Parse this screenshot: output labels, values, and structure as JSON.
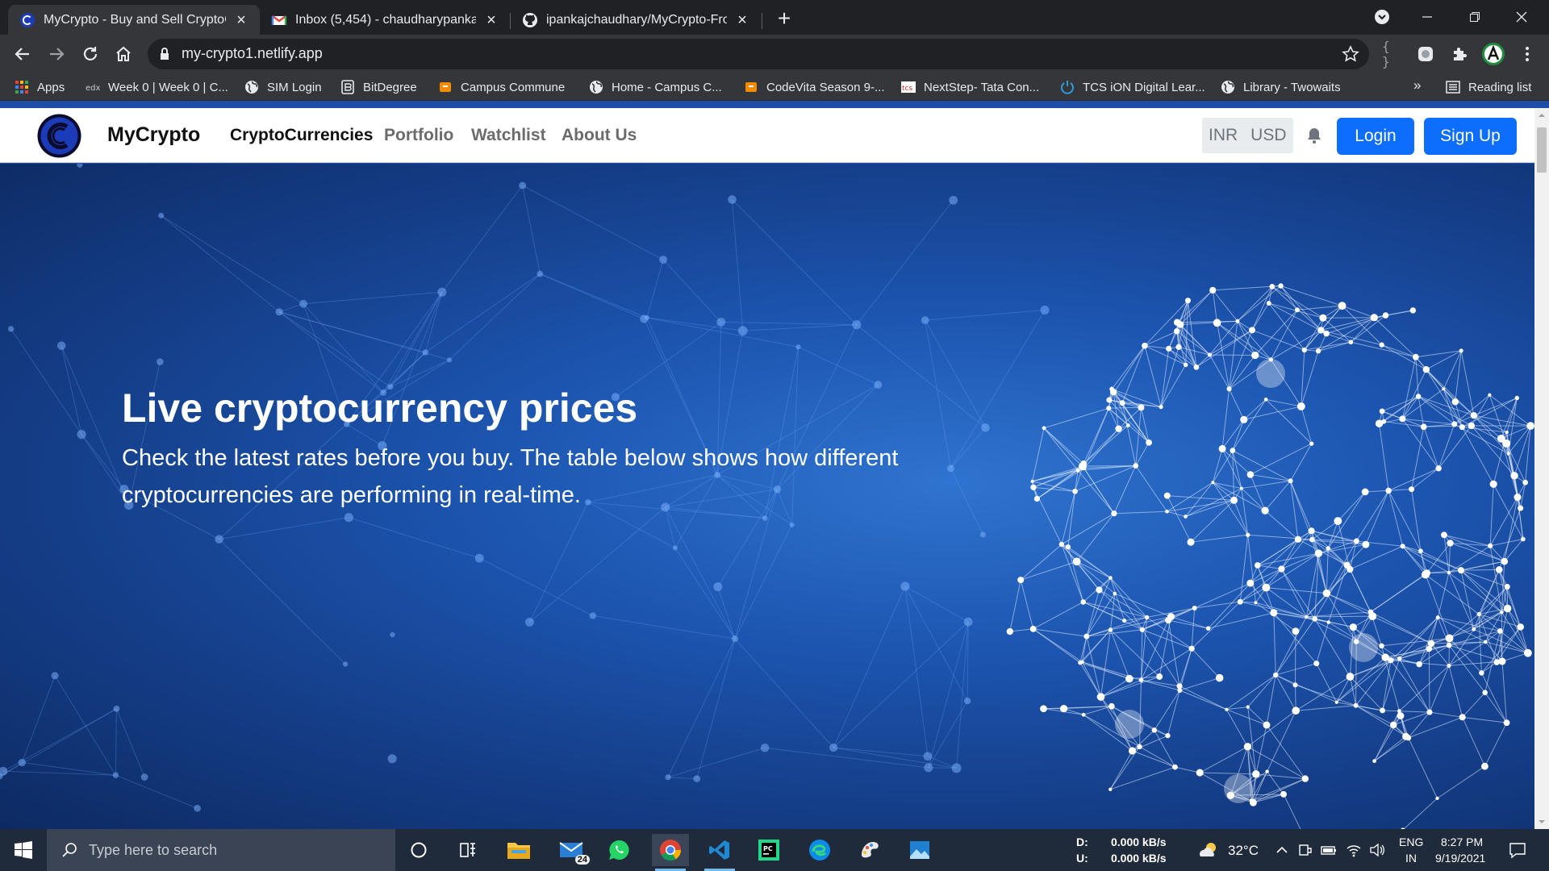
{
  "browser": {
    "tabs": [
      {
        "title": "MyCrypto - Buy and Sell CryptoC",
        "favicon": "mycrypto-icon",
        "active": true
      },
      {
        "title": "Inbox (5,454) - chaudharypankaja",
        "favicon": "gmail-icon",
        "active": false
      },
      {
        "title": "ipankajchaudhary/MyCrypto-Fro",
        "favicon": "github-icon",
        "active": false
      }
    ],
    "url": "my-crypto1.netlify.app",
    "bookmarks": [
      {
        "label": "Apps",
        "icon": "apps-grid-icon"
      },
      {
        "label": "Week 0 | Week 0 | C...",
        "icon": "edx-icon"
      },
      {
        "label": "SIM Login",
        "icon": "globe-icon"
      },
      {
        "label": "BitDegree",
        "icon": "bitdegree-icon"
      },
      {
        "label": "Campus Commune",
        "icon": "campus-icon"
      },
      {
        "label": "Home - Campus C...",
        "icon": "globe-icon"
      },
      {
        "label": "CodeVita Season 9-...",
        "icon": "campus-icon"
      },
      {
        "label": "NextStep- Tata Con...",
        "icon": "tcs-icon"
      },
      {
        "label": "TCS iON Digital Lear...",
        "icon": "power-icon"
      },
      {
        "label": "Library - Twowaits",
        "icon": "globe-icon"
      }
    ],
    "bookmarks_more": "»",
    "reading_list": "Reading list"
  },
  "site": {
    "brand": "MyCrypto",
    "nav": [
      {
        "label": "CryptoCurrencies",
        "active": true
      },
      {
        "label": "Portfolio",
        "active": false
      },
      {
        "label": "Watchlist",
        "active": false
      },
      {
        "label": "About Us",
        "active": false
      }
    ],
    "currencies": [
      "INR",
      "USD"
    ],
    "login": "Login",
    "signup": "Sign Up",
    "hero": {
      "title": "Live cryptocurrency prices",
      "subtitle": "Check the latest rates before you buy. The table below shows how different cryptocurrencies are performing in real-time."
    }
  },
  "taskbar": {
    "search_placeholder": "Type here to search",
    "mail_badge": "24",
    "net": {
      "down_label": "D:",
      "down_value": "0.000 kB/s",
      "up_label": "U:",
      "up_value": "0.000 kB/s"
    },
    "weather": "32°C",
    "lang_top": "ENG",
    "lang_bottom": "IN",
    "time": "8:27 PM",
    "date": "9/19/2021"
  },
  "colors": {
    "chrome_dark": "#202124",
    "chrome_toolbar": "#35363a",
    "accent_blue": "#0d6efd",
    "hero_blue": "#1c55b0",
    "taskbar": "#1f2a3a"
  }
}
